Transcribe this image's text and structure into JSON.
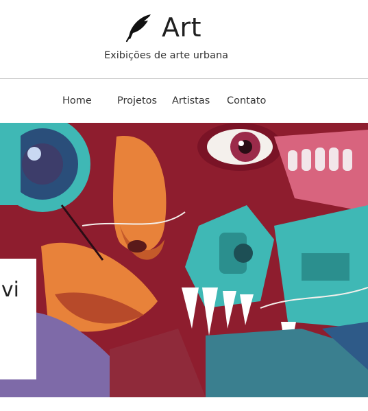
{
  "header": {
    "logo_icon": "feather-icon",
    "title": "Art",
    "tagline": "Exibições de arte urbana"
  },
  "nav": {
    "items": [
      {
        "label": "Home"
      },
      {
        "label": "Projetos"
      },
      {
        "label": "Artistas"
      },
      {
        "label": "Contato"
      }
    ]
  },
  "hero": {
    "card_title": "vi"
  },
  "colors": {
    "accent_teal": "#3fb8b5",
    "accent_red": "#a3162b",
    "accent_orange": "#e8823a",
    "divider": "#cfcfcf"
  }
}
